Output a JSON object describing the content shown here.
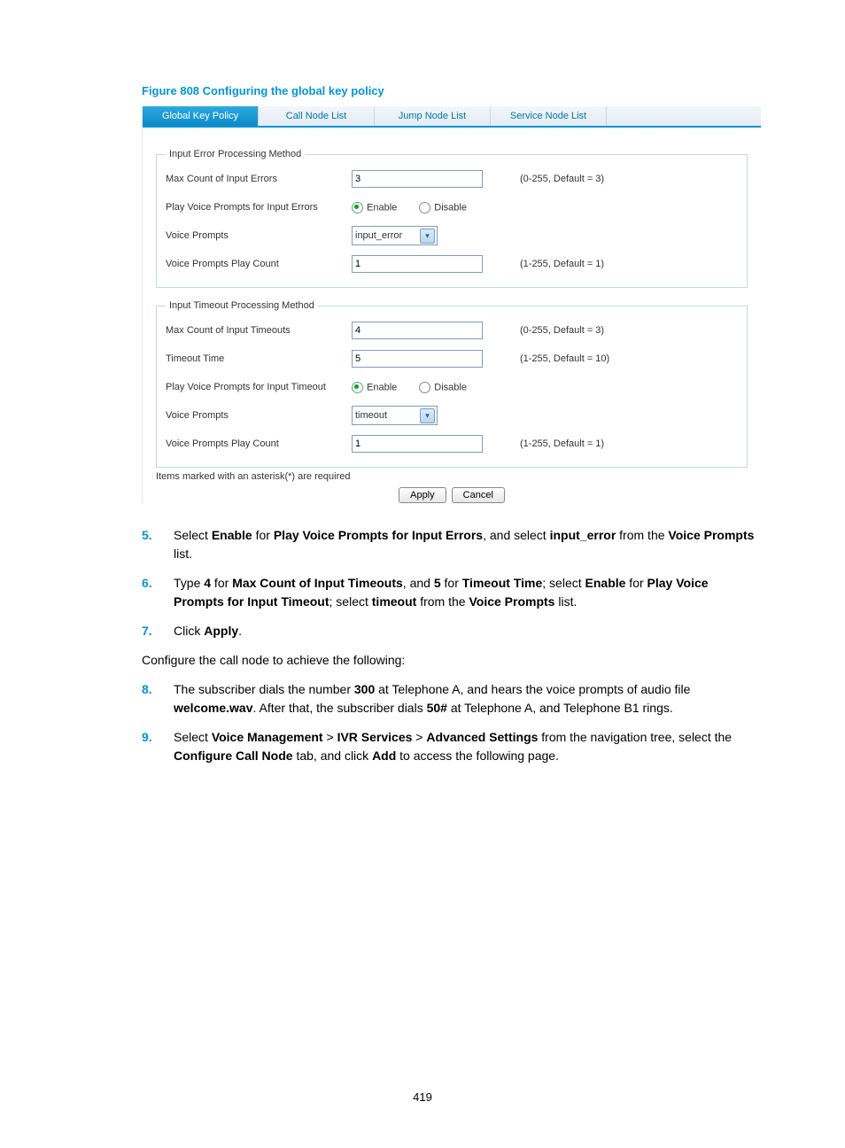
{
  "figure_title": "Figure 808 Configuring the global key policy",
  "tabs": {
    "active": "Global Key Policy",
    "t1": "Call Node List",
    "t2": "Jump Node List",
    "t3": "Service Node List"
  },
  "fs1": {
    "legend": "Input Error Processing Method",
    "max_label": "Max Count of Input Errors",
    "max_value": "3",
    "max_hint": "(0-255, Default = 3)",
    "play_label": "Play Voice Prompts for Input Errors",
    "enable": "Enable",
    "disable": "Disable",
    "vp_label": "Voice Prompts",
    "vp_value": "input_error",
    "vpc_label": "Voice Prompts Play Count",
    "vpc_value": "1",
    "vpc_hint": "(1-255, Default = 1)"
  },
  "fs2": {
    "legend": "Input Timeout Processing Method",
    "max_label": "Max Count of Input Timeouts",
    "max_value": "4",
    "max_hint": "(0-255, Default = 3)",
    "tt_label": "Timeout Time",
    "tt_value": "5",
    "tt_hint": "(1-255, Default = 10)",
    "play_label": "Play Voice Prompts for Input Timeout",
    "enable": "Enable",
    "disable": "Disable",
    "vp_label": "Voice Prompts",
    "vp_value": "timeout",
    "vpc_label": "Voice Prompts Play Count",
    "vpc_value": "1",
    "vpc_hint": "(1-255, Default = 1)"
  },
  "footnote": "Items marked with an asterisk(*) are required",
  "buttons": {
    "apply": "Apply",
    "cancel": "Cancel"
  },
  "steps": {
    "s5n": "5.",
    "s5a": "Select ",
    "s5b": "Enable",
    "s5c": " for ",
    "s5d": "Play Voice Prompts for Input Errors",
    "s5e": ", and select ",
    "s5f": "input_error",
    "s5g": " from the ",
    "s5h": "Voice Prompts",
    "s5i": " list.",
    "s6n": "6.",
    "s6a": "Type ",
    "s6b": "4",
    "s6c": " for ",
    "s6d": "Max Count of Input Timeouts",
    "s6e": ", and ",
    "s6f": "5",
    "s6g": " for ",
    "s6h": "Timeout Time",
    "s6i": "; select ",
    "s6j": "Enable",
    "s6k": " for ",
    "s6l": "Play Voice Prompts for Input Timeout",
    "s6m": "; select ",
    "s6n2": "timeout",
    "s6o": " from the ",
    "s6p": "Voice Prompts",
    "s6q": " list.",
    "s7n": "7.",
    "s7a": "Click ",
    "s7b": "Apply",
    "s7c": ".",
    "intro": "Configure the call node to achieve the following:",
    "s8n": "8.",
    "s8a": "The subscriber dials the number ",
    "s8b": "300",
    "s8c": " at Telephone A, and hears the voice prompts of audio file ",
    "s8d": "welcome.wav",
    "s8e": ". After that, the subscriber dials ",
    "s8f": "50#",
    "s8g": " at Telephone A, and Telephone B1 rings.",
    "s9n": "9.",
    "s9a": "Select ",
    "s9b": "Voice Management",
    "s9c": " > ",
    "s9d": "IVR Services",
    "s9e": " > ",
    "s9f": "Advanced Settings",
    "s9g": " from the navigation tree, select the ",
    "s9h": "Configure Call Node",
    "s9i": " tab, and click ",
    "s9j": "Add",
    "s9k": " to access the following page."
  },
  "page_number": "419"
}
